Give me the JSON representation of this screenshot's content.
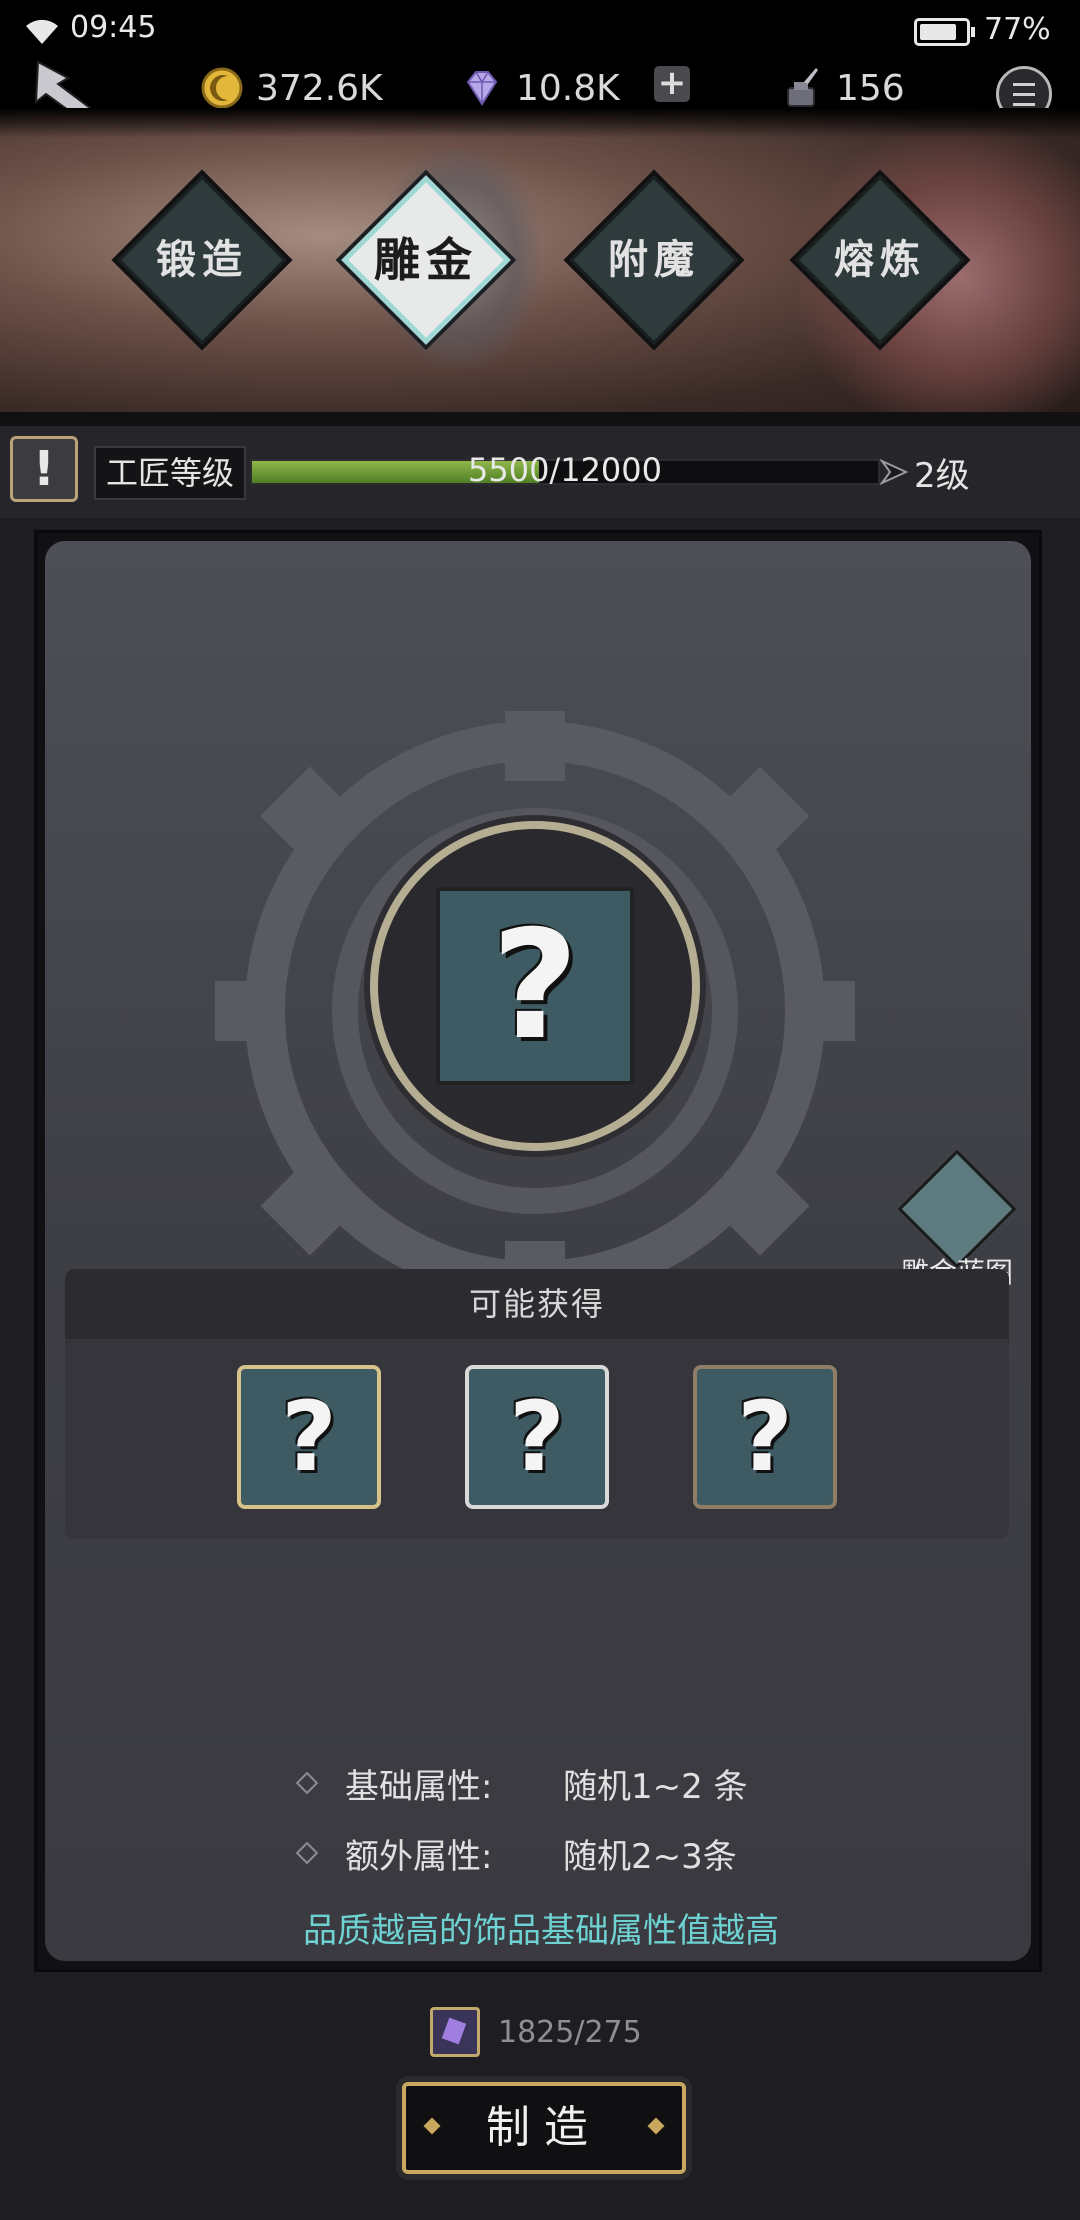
{
  "status": {
    "time": "09:45",
    "battery": "77%"
  },
  "resources": {
    "gold": "372.6K",
    "gems": "10.8K",
    "ink": "156"
  },
  "tabs": [
    {
      "label": "锻造",
      "active": false
    },
    {
      "label": "雕金",
      "active": true
    },
    {
      "label": "附魔",
      "active": false
    },
    {
      "label": "熔炼",
      "active": false
    }
  ],
  "level": {
    "label": "工匠等级",
    "progress": "5500/12000",
    "progress_fraction": 0.458,
    "next": "2级"
  },
  "main": {
    "blueprint_label": "雕金蓝图",
    "possible_title": "可能获得",
    "rewards": [
      {
        "frame_color": "#d6c38a"
      },
      {
        "frame_color": "#d9d9d9"
      },
      {
        "frame_color": "#8f7e66"
      }
    ],
    "attrs": [
      {
        "key": "基础属性:",
        "value": "随机1~2 条"
      },
      {
        "key": "额外属性:",
        "value": "随机2~3条"
      }
    ],
    "hint": "品质越高的饰品基础属性值越高"
  },
  "cost": {
    "value": "1825/275"
  },
  "make_button": "制造",
  "icons": {
    "back": "back-arrow-icon",
    "gold": "coin-icon",
    "gem": "diamond-icon",
    "ink": "ink-bottle-icon",
    "menu": "menu-icon",
    "unknown": "question-mark-icon"
  },
  "colors": {
    "accent_teal": "#6fd2d2",
    "gold_frame": "#c8a75e",
    "progress_green": "#8fb74a"
  }
}
